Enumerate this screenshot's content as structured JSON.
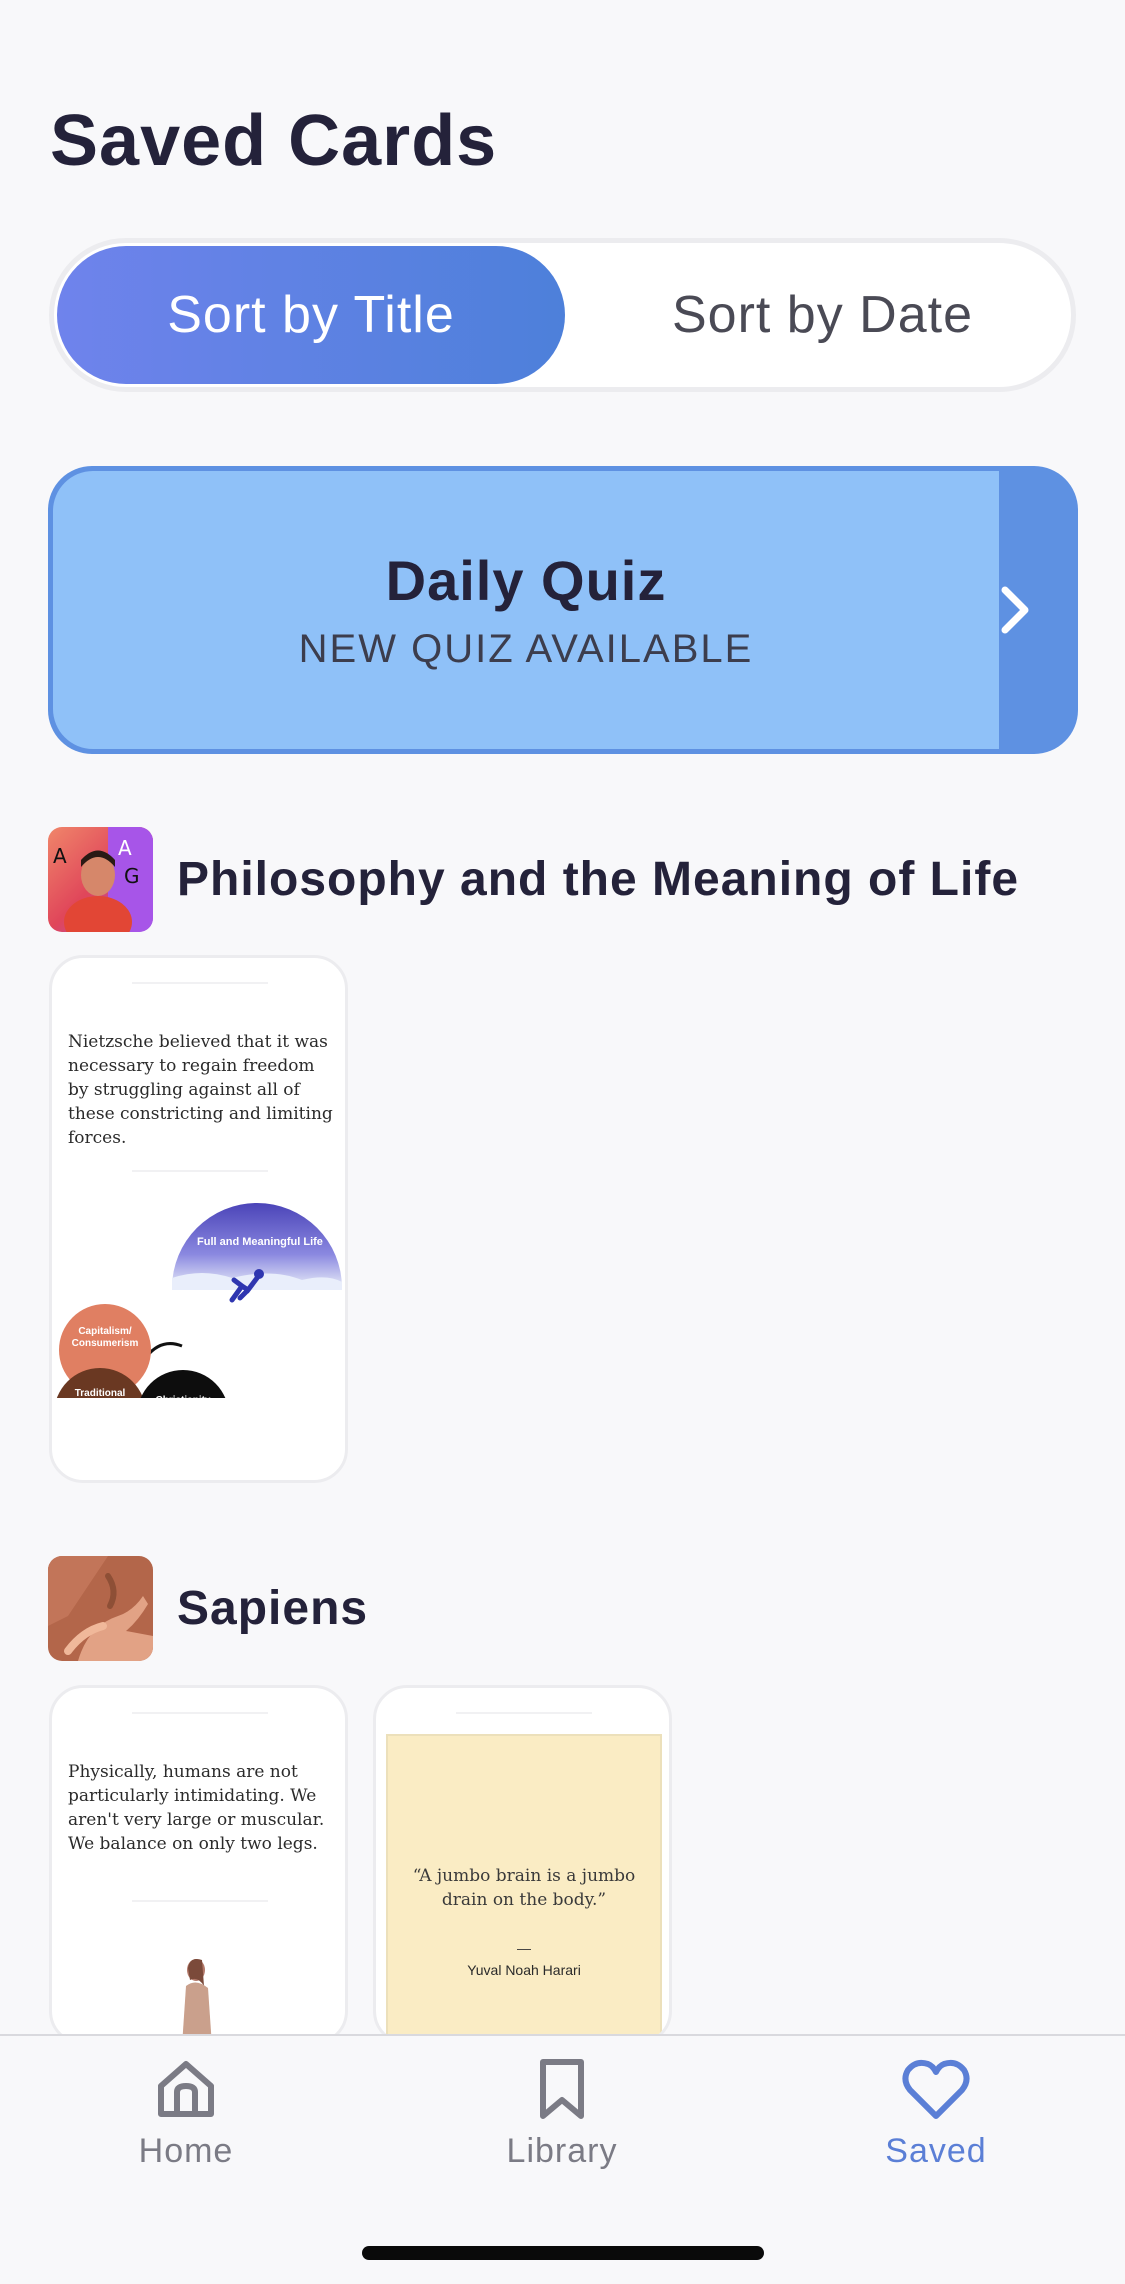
{
  "header": {
    "title": "Saved Cards"
  },
  "sort": {
    "by_title": "Sort by Title",
    "by_date": "Sort by Date",
    "selected": "Sort by Title"
  },
  "quiz": {
    "title": "Daily Quiz",
    "subtitle": "NEW QUIZ AVAILABLE"
  },
  "sections": [
    {
      "title": "Philosophy and the Meaning of Life",
      "cards": [
        {
          "text": "Nietzsche believed that it was necessary to regain freedom by struggling against all of these constricting and limiting forces.",
          "illustration": {
            "goal_label": "Full and Meaningful Life",
            "ball_labels": [
              "Capitalism/ Consumerism",
              "Traditional Education",
              "Christianity"
            ]
          }
        }
      ]
    },
    {
      "title": "Sapiens",
      "cards": [
        {
          "text": "Physically, humans are not particularly intimidating. We aren't very large or muscular. We balance on only two legs."
        },
        {
          "quote": "“A jumbo brain is a jumbo drain on the body.”",
          "dash": "—",
          "author": "Yuval Noah Harari"
        }
      ]
    }
  ],
  "tabs": [
    {
      "label": "Home",
      "icon": "home-icon",
      "active": false
    },
    {
      "label": "Library",
      "icon": "bookmark-icon",
      "active": false
    },
    {
      "label": "Saved",
      "icon": "heart-icon",
      "active": true
    }
  ],
  "colors": {
    "accent": "#5b7fd6",
    "quiz_bg": "#8fc1f8",
    "quiz_arrow_bg": "#5e91e2",
    "tab_inactive": "#7b7b85",
    "quote_bg": "#faecc4"
  }
}
